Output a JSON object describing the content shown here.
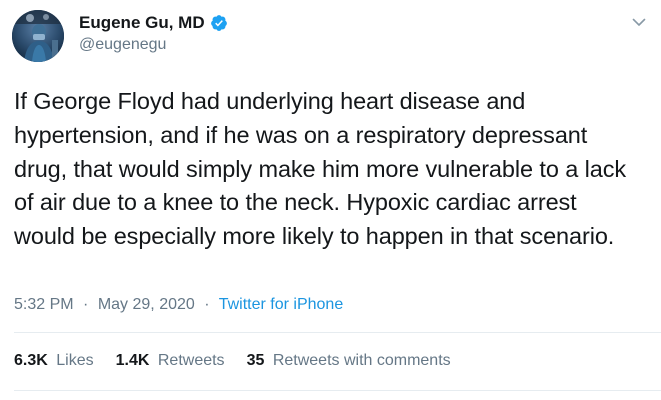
{
  "tweet": {
    "display_name": "Eugene Gu, MD",
    "handle": "@eugenegu",
    "verified": true,
    "text": "If George Floyd had underlying heart disease and hypertension, and if he was on a respiratory depressant drug, that would simply make him more vulnerable to a lack of air due to a knee to the neck. Hypoxic cardiac arrest would be especially more likely to happen in that scenario.",
    "time": "5:32 PM",
    "date": "May 29, 2020",
    "separator": "·",
    "source": "Twitter for iPhone"
  },
  "stats": {
    "likes_count": "6.3K",
    "likes_label": "Likes",
    "retweets_count": "1.4K",
    "retweets_label": "Retweets",
    "quotes_count": "35",
    "quotes_label": "Retweets with comments"
  },
  "colors": {
    "text": "#14171a",
    "secondary": "#657786",
    "accent": "#1b95e0",
    "divider": "#e6ecf0"
  },
  "icons": {
    "verified": "verified-badge-icon",
    "caret": "chevron-down-icon"
  }
}
